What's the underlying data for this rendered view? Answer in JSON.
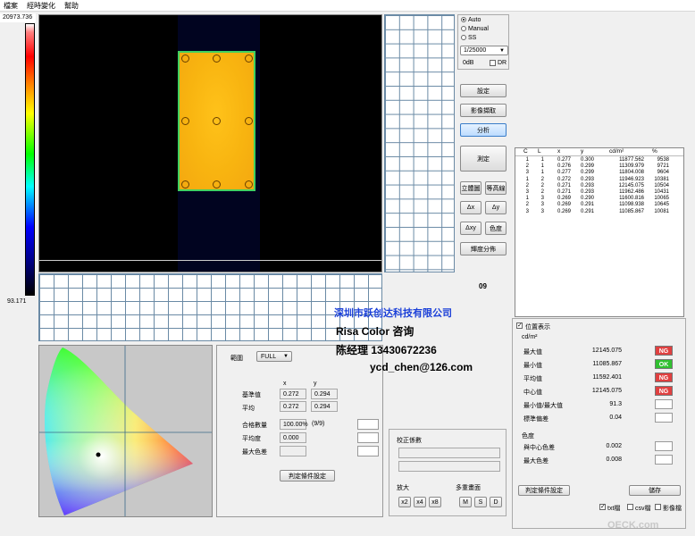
{
  "menu": [
    "檔案",
    "經時變化",
    "幫助"
  ],
  "colorbar": {
    "max_label": "20973.736",
    "min_label": "93.171"
  },
  "grid_label": "09",
  "exposure": {
    "options": [
      "Auto",
      "Manual",
      "SS"
    ],
    "selected": "Auto",
    "shutter_value": "1/25000",
    "gain_label": "0dB",
    "dr_label": "DR"
  },
  "buttons": {
    "settings": "設定",
    "capture": "影像擷取",
    "analyze": "分析",
    "measure": "測定",
    "stereo": "立體圖",
    "contour": "等高線",
    "delta_x": "Δx",
    "delta_y": "Δy",
    "delta_xy": "Δxy",
    "color_gamut": "色度",
    "luminance_dist": "輝度分佈",
    "judge_settings": "判定條件設定",
    "save": "儲存",
    "judge_settings_2": "判定條件設定"
  },
  "table": {
    "headers": [
      "C",
      "L",
      "x",
      "y",
      "cd/m²",
      "%"
    ],
    "rows": [
      [
        "1",
        "1",
        "0.277",
        "0.300",
        "11877.562",
        "9538"
      ],
      [
        "2",
        "1",
        "0.276",
        "0.299",
        "11309.979",
        "9721"
      ],
      [
        "3",
        "1",
        "0.277",
        "0.299",
        "11804.008",
        "9604"
      ],
      [
        "1",
        "2",
        "0.272",
        "0.293",
        "11946.923",
        "10381"
      ],
      [
        "2",
        "2",
        "0.271",
        "0.293",
        "12145.075",
        "10504"
      ],
      [
        "3",
        "2",
        "0.271",
        "0.293",
        "11962.486",
        "10431"
      ],
      [
        "1",
        "3",
        "0.269",
        "0.290",
        "11600.816",
        "10065"
      ],
      [
        "2",
        "3",
        "0.269",
        "0.291",
        "11098.938",
        "10645"
      ],
      [
        "3",
        "3",
        "0.269",
        "0.291",
        "11085.867",
        "10081"
      ]
    ]
  },
  "range": {
    "label": "範圍",
    "value": "FULL"
  },
  "stats": {
    "col_x": "x",
    "col_y": "y",
    "reference_label": "基準值",
    "reference_x": "0.272",
    "reference_y": "0.294",
    "average_label": "平均",
    "average_x": "0.272",
    "average_y": "0.294",
    "pass_count_label": "合格數量",
    "pass_count_value": "100.00%",
    "pass_count_ratio": "(9/9)",
    "uniformity_label": "平均度",
    "uniformity_value": "0.000",
    "max_color_diff_label": "最大色差"
  },
  "correction": {
    "title": "校正係數",
    "zoom_label": "放大",
    "zoom_buttons": [
      "x2",
      "x4",
      "x8"
    ],
    "multi_label": "多重畫面",
    "multi_buttons": [
      "M",
      "S",
      "D"
    ]
  },
  "side": {
    "position_display_label": "位置表示",
    "unit": "cd/m²",
    "metrics": [
      {
        "label": "最大值",
        "value": "12145.075",
        "status": "NG"
      },
      {
        "label": "最小值",
        "value": "11085.867",
        "status": "OK"
      },
      {
        "label": "平均值",
        "value": "11592.401",
        "status": "NG"
      },
      {
        "label": "中心值",
        "value": "12145.075",
        "status": "NG"
      },
      {
        "label": "最小值/最大值",
        "value": "91.3",
        "status": ""
      },
      {
        "label": "標準偏差",
        "value": "0.04",
        "status": ""
      }
    ],
    "chroma_title": "色度",
    "chroma_metrics": [
      {
        "label": "與中心色差",
        "value": "0.002"
      },
      {
        "label": "最大色差",
        "value": "0.008"
      }
    ],
    "export_options": [
      "txt檔",
      "csv檔",
      "影像檔"
    ]
  },
  "status_colors": {
    "ng": "#e04040",
    "ok": "#30c030"
  },
  "watermark": {
    "company": "深圳市跃创达科技有限公司",
    "product": "Risa Color 咨询",
    "contact": "陈经理  13430672236",
    "email": "ycd_chen@126.com"
  },
  "corner_logo": "OECK.com"
}
